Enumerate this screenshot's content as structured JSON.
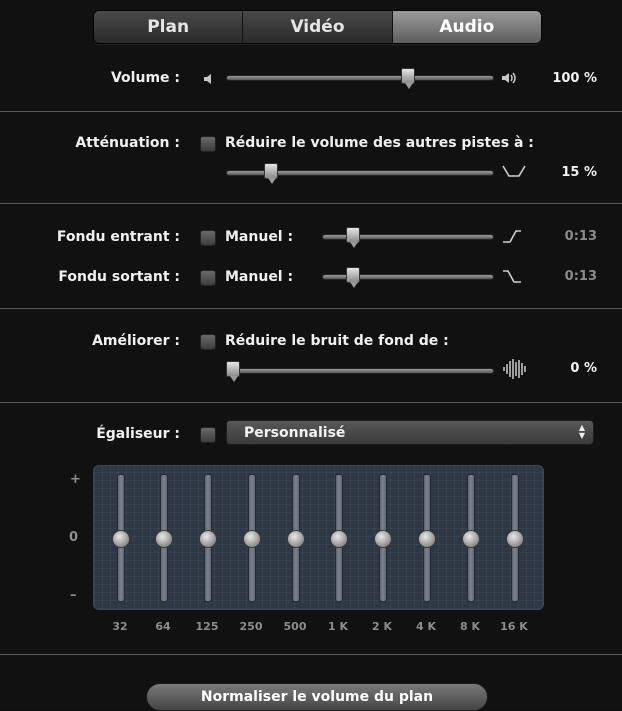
{
  "tabs": [
    {
      "label": "Plan",
      "active": false
    },
    {
      "label": "Vidéo",
      "active": false
    },
    {
      "label": "Audio",
      "active": true
    }
  ],
  "volume": {
    "label": "Volume :",
    "value": "100 %",
    "level": 0.69
  },
  "attenuation": {
    "label": "Atténuation :",
    "checkbox_label": "Réduire le volume des autres pistes à :",
    "checked": false,
    "value": "15 %",
    "level": 0.15
  },
  "fade_in": {
    "label": "Fondu entrant :",
    "checkbox_label": "Manuel :",
    "checked": false,
    "value": "0:13",
    "level": 0.15
  },
  "fade_out": {
    "label": "Fondu sortant :",
    "checkbox_label": "Manuel :",
    "checked": false,
    "value": "0:13",
    "level": 0.15
  },
  "enhance": {
    "label": "Améliorer :",
    "checkbox_label": "Réduire le bruit de fond de :",
    "checked": false,
    "value": "0 %",
    "level": 0.0
  },
  "equalizer": {
    "label": "Égaliseur :",
    "checked": false,
    "preset": "Personnalisé",
    "scale_plus": "+",
    "scale_zero": "0",
    "scale_minus": "–",
    "bands": [
      "32",
      "64",
      "125",
      "250",
      "500",
      "1 K",
      "2 K",
      "4 K",
      "8 K",
      "16 K"
    ],
    "gains": [
      0,
      0,
      0,
      0,
      0,
      0,
      0,
      0,
      0,
      0
    ]
  },
  "normalize_button": "Normaliser le volume du plan",
  "colors": {
    "background": "#111111",
    "eq_panel": "#2e3845",
    "dim_value": "#8b8b8b"
  }
}
